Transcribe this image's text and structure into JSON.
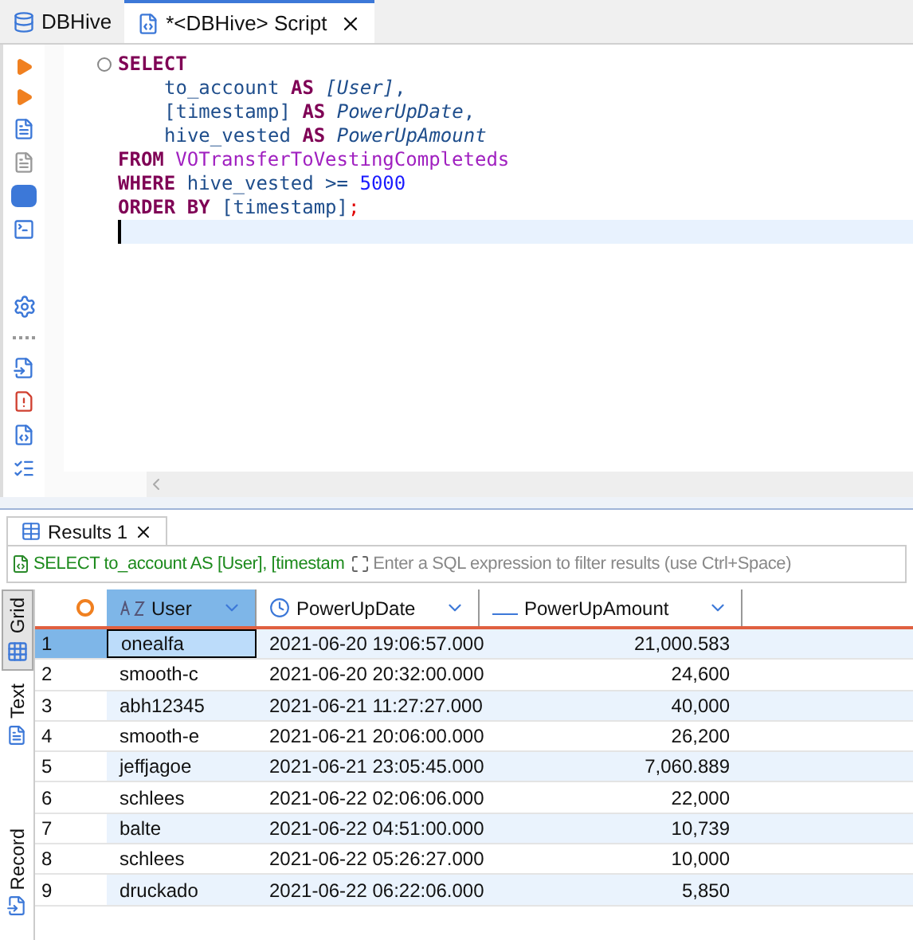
{
  "editor_tabs": [
    {
      "label": "DBHive",
      "kind": "database",
      "selected": false,
      "closable": false
    },
    {
      "label": "*<DBHive> Script",
      "kind": "script",
      "selected": true,
      "closable": true
    }
  ],
  "code_lines": [
    [
      {
        "kind": "keyword",
        "text": "SELECT"
      }
    ],
    [
      {
        "kind": "ident",
        "indented": true,
        "text": "to_account "
      },
      {
        "kind": "keyword",
        "text": "AS "
      },
      {
        "kind": "alias",
        "text": "[User]"
      },
      {
        "kind": "ident",
        "text": ","
      }
    ],
    [
      {
        "kind": "ident",
        "indented": true,
        "text": "[timestamp] "
      },
      {
        "kind": "keyword",
        "text": "AS "
      },
      {
        "kind": "alias",
        "text": "PowerUpDate"
      },
      {
        "kind": "ident",
        "text": ","
      }
    ],
    [
      {
        "kind": "ident",
        "indented": true,
        "text": "hive_vested "
      },
      {
        "kind": "keyword",
        "text": "AS "
      },
      {
        "kind": "alias",
        "text": "PowerUpAmount"
      }
    ],
    [
      {
        "kind": "keyword",
        "text": "FROM "
      },
      {
        "kind": "table",
        "text": "VOTransferToVestingCompleteds"
      }
    ],
    [
      {
        "kind": "keyword",
        "text": "WHERE "
      },
      {
        "kind": "ident",
        "text": "hive_vested >= "
      },
      {
        "kind": "number",
        "text": "5000"
      }
    ],
    [
      {
        "kind": "keyword",
        "text": "ORDER BY "
      },
      {
        "kind": "ident",
        "text": "[timestamp]"
      },
      {
        "kind": "punct",
        "text": ";"
      }
    ]
  ],
  "results_tab": {
    "label": "Results 1"
  },
  "filter": {
    "query": "SELECT to_account AS [User], [timestam",
    "placeholder": "Enter a SQL expression to filter results (use Ctrl+Space)"
  },
  "side_tabs": [
    {
      "label": "Grid",
      "selected": true
    },
    {
      "label": "Text",
      "selected": false
    },
    {
      "label": "Record",
      "selected": false
    }
  ],
  "columns": [
    {
      "label": "User",
      "kind": "text",
      "selected": true
    },
    {
      "label": "PowerUpDate",
      "kind": "date",
      "selected": false
    },
    {
      "label": "PowerUpAmount",
      "kind": "number",
      "selected": false
    }
  ],
  "rows": [
    {
      "num": "1",
      "cells": [
        "onealfa",
        "2021-06-20 19:06:57.000",
        "21,000.583"
      ],
      "selected": true
    },
    {
      "num": "2",
      "cells": [
        "smooth-c",
        "2021-06-20 20:32:00.000",
        "24,600"
      ],
      "selected": false
    },
    {
      "num": "3",
      "cells": [
        "abh12345",
        "2021-06-21 11:27:27.000",
        "40,000"
      ],
      "selected": false
    },
    {
      "num": "4",
      "cells": [
        "smooth-e",
        "2021-06-21 20:06:00.000",
        "26,200"
      ],
      "selected": false
    },
    {
      "num": "5",
      "cells": [
        "jeffjagoe",
        "2021-06-21 23:05:45.000",
        "7,060.889"
      ],
      "selected": false
    },
    {
      "num": "6",
      "cells": [
        "schlees",
        "2021-06-22 02:06:06.000",
        "22,000"
      ],
      "selected": false
    },
    {
      "num": "7",
      "cells": [
        "balte",
        "2021-06-22 04:51:00.000",
        "10,739"
      ],
      "selected": false
    },
    {
      "num": "8",
      "cells": [
        "schlees",
        "2021-06-22 05:26:27.000",
        "10,000"
      ],
      "selected": false
    },
    {
      "num": "9",
      "cells": [
        "druckado",
        "2021-06-22 06:22:06.000",
        "5,850"
      ],
      "selected": false
    }
  ]
}
